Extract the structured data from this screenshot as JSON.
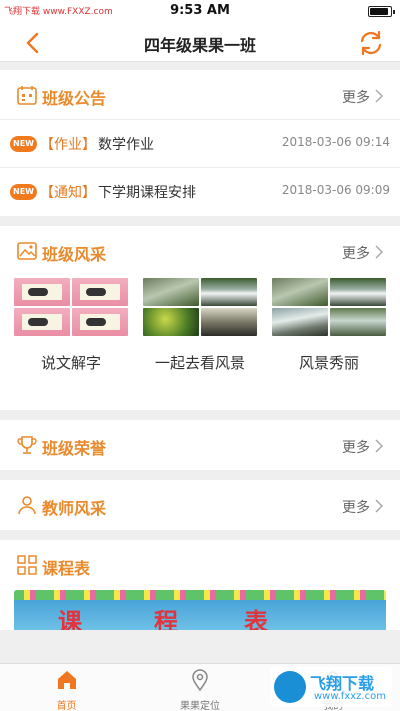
{
  "status_bar": {
    "left_text": "飞翔下载 www.FXXZ.com",
    "time": "9:53 AM"
  },
  "nav": {
    "title": "四年级果果一班"
  },
  "announcements": {
    "title": "班级公告",
    "more": "更多",
    "items": [
      {
        "badge": "NEW",
        "tag": "【作业】",
        "text": "数学作业",
        "time": "2018-03-06 09:14"
      },
      {
        "badge": "NEW",
        "tag": "【通知】",
        "text": "下学期课程安排",
        "time": "2018-03-06 09:09"
      }
    ]
  },
  "gallery": {
    "title": "班级风采",
    "more": "更多",
    "albums": [
      {
        "label": "说文解字"
      },
      {
        "label": "一起去看风景"
      },
      {
        "label": "风景秀丽"
      }
    ]
  },
  "honors": {
    "title": "班级荣誉",
    "more": "更多"
  },
  "teachers": {
    "title": "教师风采",
    "more": "更多"
  },
  "schedule": {
    "title": "课程表",
    "banner_text": [
      "课",
      "程",
      "表"
    ]
  },
  "tabs": [
    {
      "label": "首页"
    },
    {
      "label": "果果定位"
    },
    {
      "label": "我的"
    }
  ],
  "watermark": {
    "title": "飞翔下载",
    "sub": "www.fxxz.com"
  },
  "colors": {
    "accent": "#f0771f",
    "title_orange": "#e98a2d"
  }
}
